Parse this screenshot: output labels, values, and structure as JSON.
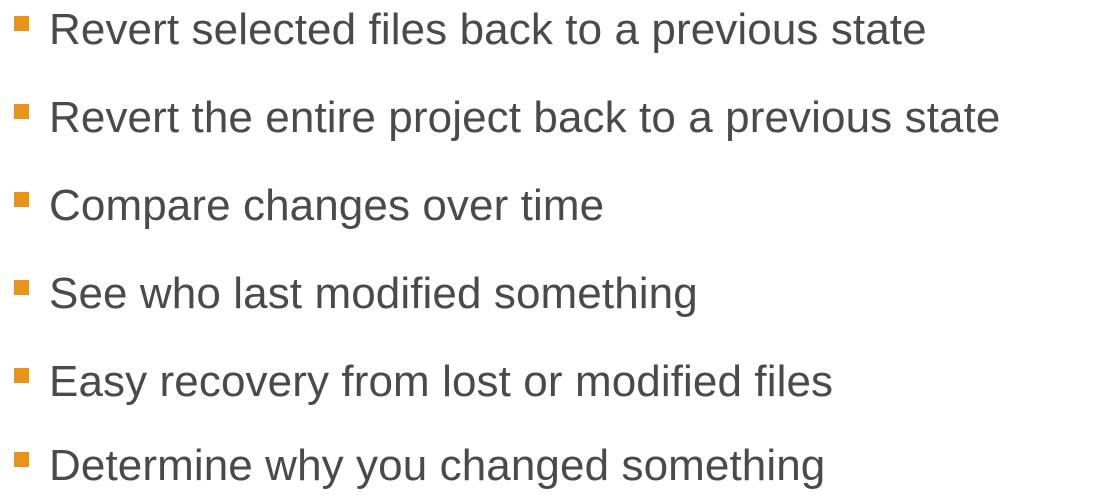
{
  "colors": {
    "bullet": "#e8941a",
    "text": "#4a4a4a",
    "background": "#ffffff"
  },
  "bullets": [
    {
      "icon": "square-bullet-icon",
      "text": "Revert selected files back to a previous state"
    },
    {
      "icon": "square-bullet-icon",
      "text": "Revert the entire project back to a previous state"
    },
    {
      "icon": "square-bullet-icon",
      "text": "Compare changes over time"
    },
    {
      "icon": "square-bullet-icon",
      "text": "See who last modified something"
    },
    {
      "icon": "square-bullet-icon",
      "text": "Easy recovery from lost or modified files"
    },
    {
      "icon": "square-bullet-icon",
      "text": "Determine why you changed something"
    }
  ]
}
